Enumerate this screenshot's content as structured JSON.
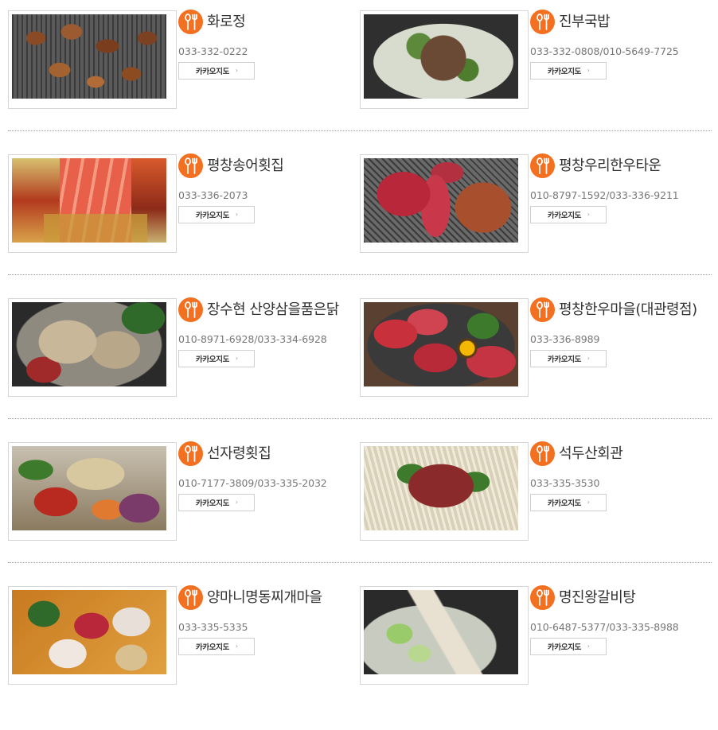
{
  "icons": {
    "category": "fork-spoon-icon",
    "arrow": "chevron-right-icon"
  },
  "colors": {
    "accent": "#f37021",
    "divider": "#9a9a9a",
    "button_border": "#cfcfcf",
    "phone_text": "#777777"
  },
  "map_button_label": "카카오지도",
  "arrow_glyph": "›",
  "restaurants": [
    {
      "name": "화로정",
      "phone": "033-332-0222",
      "photo": "grilled-pork-on-grill"
    },
    {
      "name": "진부국밥",
      "phone": "033-332-0808/010-5649-7725",
      "photo": "beef-soup-hotpot"
    },
    {
      "name": "평창송어횟집",
      "phone": "033-336-2073",
      "photo": "trout-sashimi-platter"
    },
    {
      "name": "평창우리한우타운",
      "phone": "010-8797-1592/033-336-9211",
      "photo": "raw-beef-on-grill"
    },
    {
      "name": "장수현 산양삼을품은닭",
      "phone": "010-8971-6928/033-334-6928",
      "photo": "chicken-hotpot-with-mushrooms"
    },
    {
      "name": "평창한우마을(대관령점)",
      "phone": "033-336-8989",
      "photo": "marbled-beef-platter"
    },
    {
      "name": "선자령횟집",
      "phone": "010-7177-3809/033-335-2032",
      "photo": "raw-fish-salad"
    },
    {
      "name": "석두산회관",
      "phone": "033-335-3530",
      "photo": "bulgogi-hotpot-with-enoki"
    },
    {
      "name": "양마니명동찌개마을",
      "phone": "033-335-5335",
      "photo": "budae-jjigae-pot"
    },
    {
      "name": "명진왕갈비탕",
      "phone": "010-6487-5377/033-335-8988",
      "photo": "galbitang-soup"
    }
  ]
}
